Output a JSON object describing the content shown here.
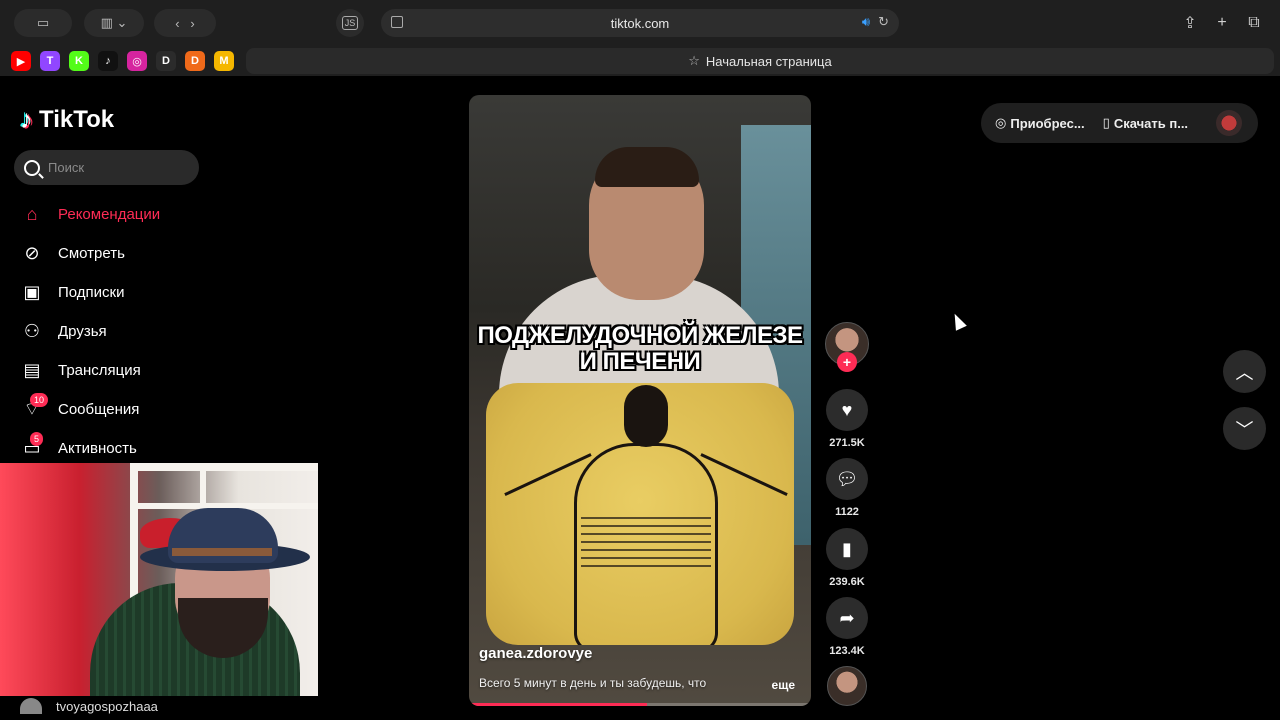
{
  "browser": {
    "url": "tiktok.com",
    "js_label": "JS",
    "start_tab_label": "Начальная страница",
    "bookmarks": [
      {
        "name": "youtube-icon",
        "glyph": "▶",
        "color": "#ff0000"
      },
      {
        "name": "twitch-icon",
        "glyph": "T",
        "color": "#9146ff"
      },
      {
        "name": "kick-icon",
        "glyph": "K",
        "color": "#53fc18"
      },
      {
        "name": "tiktok-bookmark-icon",
        "glyph": "♪",
        "color": "#111111"
      },
      {
        "name": "instagram-icon",
        "glyph": "◎",
        "color": "#d6249f"
      },
      {
        "name": "donationalerts-icon",
        "glyph": "D",
        "color": "#2b2b2b"
      },
      {
        "name": "boosty-icon",
        "glyph": "D",
        "color": "#f06a1a"
      },
      {
        "name": "memealerts-icon",
        "glyph": "M",
        "color": "#f5b700"
      }
    ]
  },
  "sidebar": {
    "logo_text": "TikTok",
    "search_placeholder": "Поиск",
    "items": [
      {
        "label": "Рекомендации",
        "icon": "home-icon",
        "active": true
      },
      {
        "label": "Смотреть",
        "icon": "compass-icon"
      },
      {
        "label": "Подписки",
        "icon": "following-icon"
      },
      {
        "label": "Друзья",
        "icon": "friends-icon"
      },
      {
        "label": "Трансляция",
        "icon": "live-icon"
      },
      {
        "label": "Сообщения",
        "icon": "messages-icon",
        "badge": "10"
      },
      {
        "label": "Активность",
        "icon": "activity-icon",
        "badge": "5"
      }
    ],
    "account": "tvoyagospozhaaa"
  },
  "video": {
    "caption": "ПОДЖЕЛУДОЧНОЙ ЖЕЛЕЗЕ И ПЕЧЕНИ",
    "username": "ganea.zdorovye",
    "description": "Всего 5 минут в день и ты забудешь, что",
    "more_label": "еще",
    "progress_fraction": 0.52
  },
  "actions": {
    "likes": "271.5K",
    "comments": "1122",
    "saves": "239.6K",
    "shares": "123.4K"
  },
  "top_right": {
    "coins_label": "Приобрес...",
    "download_label": "Скачать п..."
  },
  "colors": {
    "accent": "#fe2c55",
    "background": "#000000",
    "surface": "#2a2a2a"
  }
}
